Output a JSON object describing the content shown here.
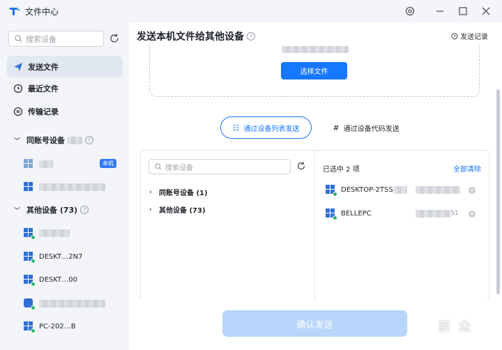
{
  "app": {
    "title": "文件中心"
  },
  "sidebar": {
    "search_placeholder": "搜索设备",
    "nav": [
      {
        "label": "发送文件",
        "active": true,
        "icon": "send-icon"
      },
      {
        "label": "最近文件",
        "active": false,
        "icon": "clock-icon"
      },
      {
        "label": "传输记录",
        "active": false,
        "icon": "transfer-icon"
      }
    ],
    "groups": [
      {
        "label": "同账号设备",
        "count_text": ""
      },
      {
        "label": "其他设备 (73)",
        "count_text": ""
      }
    ],
    "local_badge": "本机",
    "other_devices": [
      "DESKT…2N7",
      "DESKT…00",
      "",
      "PC-202…B"
    ]
  },
  "main": {
    "title": "发送本机文件给其他设备",
    "history_link": "发送记录",
    "select_file_button": "选择文件",
    "mode_list": "通过设备列表发送",
    "mode_code": "通过设备代码发送",
    "search_placeholder": "搜索设备",
    "tree": [
      "同账号设备 (1)",
      "其他设备 (73)"
    ],
    "selected_count": "已选中 2 项",
    "clear_all": "全部清除",
    "selected_devices": [
      {
        "name": "DESKTOP-2TSS",
        "ip": ""
      },
      {
        "name": "BELLEPC",
        "ip": "51"
      }
    ],
    "confirm_button": "确认发送"
  },
  "watermark": "新 众"
}
